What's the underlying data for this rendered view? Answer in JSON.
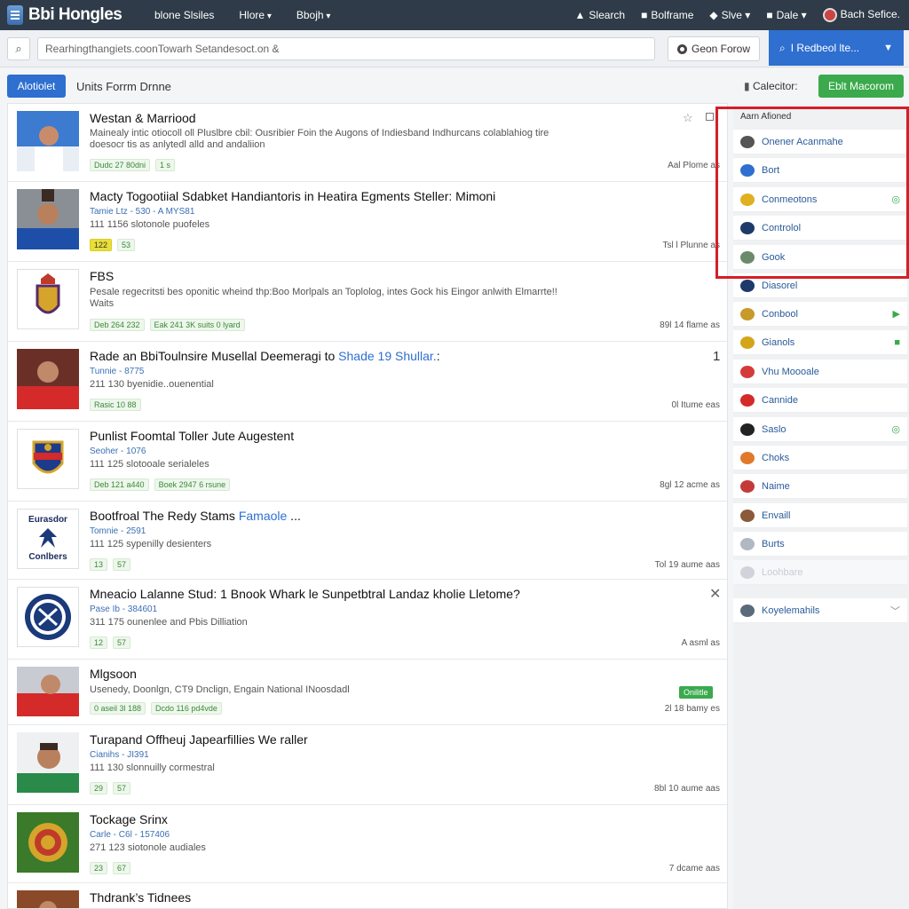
{
  "brand": {
    "name": "Bbi Hongles"
  },
  "topnav": {
    "items": [
      "blone Slsiles",
      "Hlore",
      "Bbojh"
    ]
  },
  "topright": {
    "search": "Slearch",
    "bolframe": "Bolframe",
    "slve": "Slve",
    "dale": "Dale",
    "user": "Bach Sefice."
  },
  "search": {
    "value": "Rearhingthangiets.coonTowarh Setandesoct.on &",
    "gen_button": "Geon Forow",
    "primary": "I Redbeol lte..."
  },
  "tabs": {
    "active": "Alotiolet",
    "label": "Units Forrm Drnne",
    "calendar": "Calecitor:",
    "add_button": "Eblt Macorom"
  },
  "feed": [
    {
      "title": "Westan & Marriood",
      "lines": [
        "Mainealy intic otiocoll oll Pluslbre cbil: Ousribier Foin the Augons of Indiesband Indhurcans colablahiog tire",
        "doesocr tis as anlytedl alld and andaliion"
      ],
      "tags": [
        "Dudc 27 80dni",
        "1 s"
      ],
      "time": "Aal Plome as",
      "extras": [
        "star",
        "square"
      ]
    },
    {
      "title": "Macty Togootiial Sdabket Handiantoris in Heatira Egments Steller: Mimoni",
      "sub": "Tamie Ltz - 530 - A MYS81",
      "lines": [
        "111 1156 slotonole puofeles"
      ],
      "tags": [
        "122",
        "53"
      ],
      "time": "Tsl l Plunne as"
    },
    {
      "title": "FBS",
      "lines": [
        "Pesale regecritsti bes oponitic wheind thp:Boo Morlpals an Toplolog, intes Gock his Eingor anlwith Elmarrte!!",
        "Waits"
      ],
      "tags": [
        "Deb 264 232",
        "Eak 241 3K suits 0 lyard"
      ],
      "time": "89l 14 flame as"
    },
    {
      "title": "Rade an BbiToulnsire Musellal Deemeragi to ",
      "title_hl": "Shade 19 Shullar.",
      "title_tail": ":",
      "sub": "Tunnie - 8775",
      "lines": [
        "211 130 byenidie..ouenential"
      ],
      "tags": [
        "Rasic 10 88"
      ],
      "time": "0l Itume eas",
      "extras": [
        "one"
      ]
    },
    {
      "title": "Punlist Foomtal Toller Jute Augestent",
      "sub": "Seoher - 1076",
      "lines": [
        "111 125 slotooale serialeles"
      ],
      "tags": [
        "Deb 121 a440",
        "Boek 2947 6 rsune"
      ],
      "time": "8gl 12 acme as"
    },
    {
      "title": "Bootfroal The Redy Stams ",
      "title_hl": "Famaole",
      "title_tail": " ...",
      "sub": "Tomnie - 2591",
      "lines": [
        "111 125 sypenilly desienters"
      ],
      "tags": [
        "13",
        "57"
      ],
      "time": "Tol 19 aume aas",
      "logo_text": [
        "Eurasdor",
        "Conlbers"
      ]
    },
    {
      "title": "Mneacio Lalanne Stud: 1 Bnook Whark le Sunpetbtral Landaz kholie Lletome?",
      "sub": "Pase Ib - 384601",
      "lines": [
        "311 175 ounenlee and Pbis Dilliation"
      ],
      "tags": [
        "12",
        "57"
      ],
      "time": "A asml as",
      "extras": [
        "close"
      ]
    },
    {
      "title": "Mlgsoon",
      "lines": [
        "Usenedy, Doonlgn, CT9 Dnclign, Engain National INoosdadl"
      ],
      "tags": [
        "0 aseil 3l 188",
        "Dcdo 116 pd4vde"
      ],
      "time": "2l 18 bamy es",
      "badge": "Onilitle"
    },
    {
      "title": "Turapand Offheuj Japearfillies We raller",
      "sub": "Cianihs - JI391",
      "lines": [
        "111 130 slonnuilly cormestral"
      ],
      "tags": [
        "29",
        "57"
      ],
      "time": "8bl 10 aume aas"
    },
    {
      "title": "Tockage Srinx",
      "sub": "Carle - C6l - 157406",
      "lines": [
        "271 123 siotonole audiales"
      ],
      "tags": [
        "23",
        "67"
      ],
      "time": "7 dcame aas"
    },
    {
      "title": "Thdrank’s Tidnees",
      "lines": [],
      "tags": [],
      "time": ""
    }
  ],
  "sidebar": {
    "heading": "Aarn Afioned",
    "items": [
      {
        "label": "Onener Acanmahe",
        "icon": "avatar-icon",
        "color": "#555555"
      },
      {
        "label": "Bort",
        "icon": "b-icon",
        "color": "#2e6fd0"
      },
      {
        "label": "Conmeotons",
        "icon": "coin-icon",
        "color": "#e0b020",
        "end": "◎"
      },
      {
        "label": "Controlol",
        "icon": "chart-icon",
        "color": "#1e3a6a"
      },
      {
        "label": "Gook",
        "icon": "image-icon",
        "color": "#6b8a6b"
      },
      {
        "label": "Diasorel",
        "icon": "logo-icon",
        "color": "#1e3a6a"
      },
      {
        "label": "Conbool",
        "icon": "award-icon",
        "color": "#c79a2a",
        "end": "▶"
      },
      {
        "label": "Gianols",
        "icon": "badge-icon",
        "color": "#d4a51a",
        "end": "■"
      },
      {
        "label": "Vhu Moooale",
        "icon": "shield-icon",
        "color": "#d43a3a"
      },
      {
        "label": "Cannide",
        "icon": "circle-icon",
        "color": "#d42a2a"
      },
      {
        "label": "Saslo",
        "icon": "disc-icon",
        "color": "#222222",
        "end": "◎"
      },
      {
        "label": "Choks",
        "icon": "drumstick-icon",
        "color": "#e07a2a"
      },
      {
        "label": "Naime",
        "icon": "card-icon",
        "color": "#c43a3a"
      },
      {
        "label": "Envaill",
        "icon": "pencil-icon",
        "color": "#8a5a3a"
      },
      {
        "label": "Burts",
        "icon": "flag-icon",
        "color": "#b0b8c4"
      },
      {
        "label": "Loohbare",
        "icon": "ghost-icon",
        "color": "#d0d4da"
      },
      {
        "label": "Koyelemahils",
        "icon": "gallery-icon",
        "color": "#5a6a7a",
        "end": "﹀"
      }
    ]
  },
  "colors": {
    "topbar": "#2f3b48",
    "accent": "#2e6fd0",
    "green": "#3aaa4c",
    "highlight": "#d41f26"
  }
}
